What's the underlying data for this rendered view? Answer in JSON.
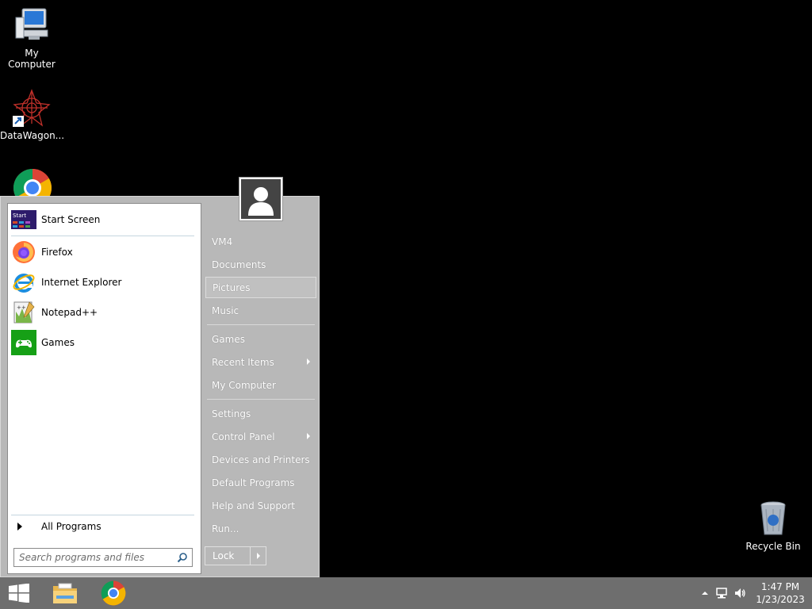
{
  "desktop": {
    "icons": [
      {
        "label": "My Computer",
        "icon": "computer-icon"
      },
      {
        "label": "DataWagon...",
        "icon": "datawagon-icon"
      },
      {
        "label": "",
        "icon": "chrome-icon"
      },
      {
        "label": "Recycle Bin",
        "icon": "recycle-bin-icon"
      }
    ]
  },
  "start_menu": {
    "programs": [
      {
        "label": "Start Screen",
        "icon": "start-screen-icon"
      },
      {
        "label": "Firefox",
        "icon": "firefox-icon"
      },
      {
        "label": "Internet Explorer",
        "icon": "internet-explorer-icon"
      },
      {
        "label": "Notepad++",
        "icon": "notepadpp-icon"
      },
      {
        "label": "Games",
        "icon": "games-icon"
      }
    ],
    "start_screen_tile_text": "Start",
    "all_programs": "All Programs",
    "search_placeholder": "Search programs and files",
    "right_items": [
      {
        "label": "VM4"
      },
      {
        "label": "Documents"
      },
      {
        "label": "Pictures",
        "highlighted": true
      },
      {
        "label": "Music"
      },
      {
        "label": "Games"
      },
      {
        "label": "Recent Items",
        "submenu": true
      },
      {
        "label": "My Computer"
      },
      {
        "label": "Settings"
      },
      {
        "label": "Control Panel",
        "submenu": true
      },
      {
        "label": "Devices and Printers"
      },
      {
        "label": "Default Programs"
      },
      {
        "label": "Help and Support"
      },
      {
        "label": "Run..."
      }
    ],
    "lock_label": "Lock"
  },
  "taskbar": {
    "apps": [
      {
        "icon": "file-explorer-icon"
      },
      {
        "icon": "chrome-icon"
      }
    ],
    "tray": {
      "time": "1:47 PM",
      "date": "1/23/2023"
    }
  },
  "colors": {
    "desktop_bg": "#000000",
    "taskbar_bg": "#6e6e6e",
    "menu_bg": "#b8b8b8"
  }
}
